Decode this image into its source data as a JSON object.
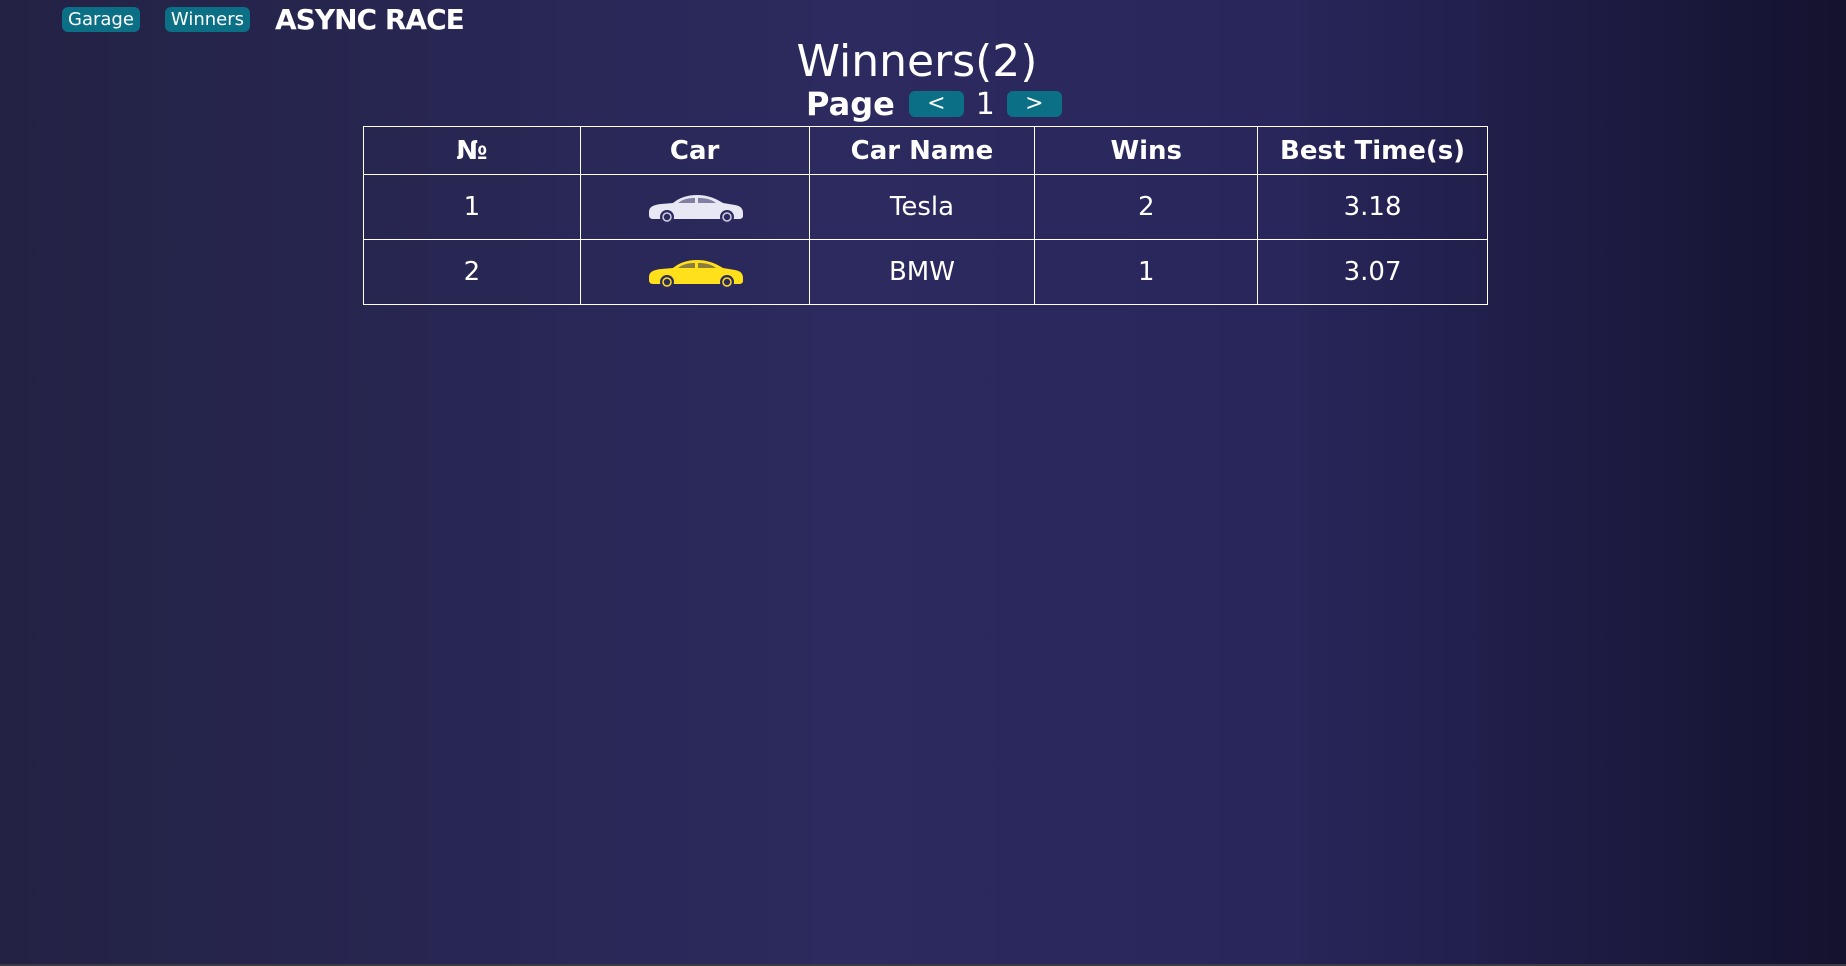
{
  "header": {
    "garage_label": "Garage",
    "winners_label": "Winners",
    "app_title": "ASYNC RACE"
  },
  "main": {
    "title": "Winners(2)",
    "pager": {
      "label": "Page",
      "prev_label": "<",
      "page_number": "1",
      "next_label": ">"
    },
    "table": {
      "columns": [
        "№",
        "Car",
        "Car Name",
        "Wins",
        "Best Time(s)"
      ],
      "rows": [
        {
          "number": "1",
          "car_icon": "car-icon",
          "car_color": "#e8e8f4",
          "name": "Tesla",
          "wins": "2",
          "best_time": "3.18"
        },
        {
          "number": "2",
          "car_icon": "car-icon",
          "car_color": "#ffe01a",
          "name": "BMW",
          "wins": "1",
          "best_time": "3.07"
        }
      ]
    }
  },
  "colors": {
    "button_bg": "#0b6f86",
    "background": "#2c2a5e",
    "text": "#ffffff"
  }
}
